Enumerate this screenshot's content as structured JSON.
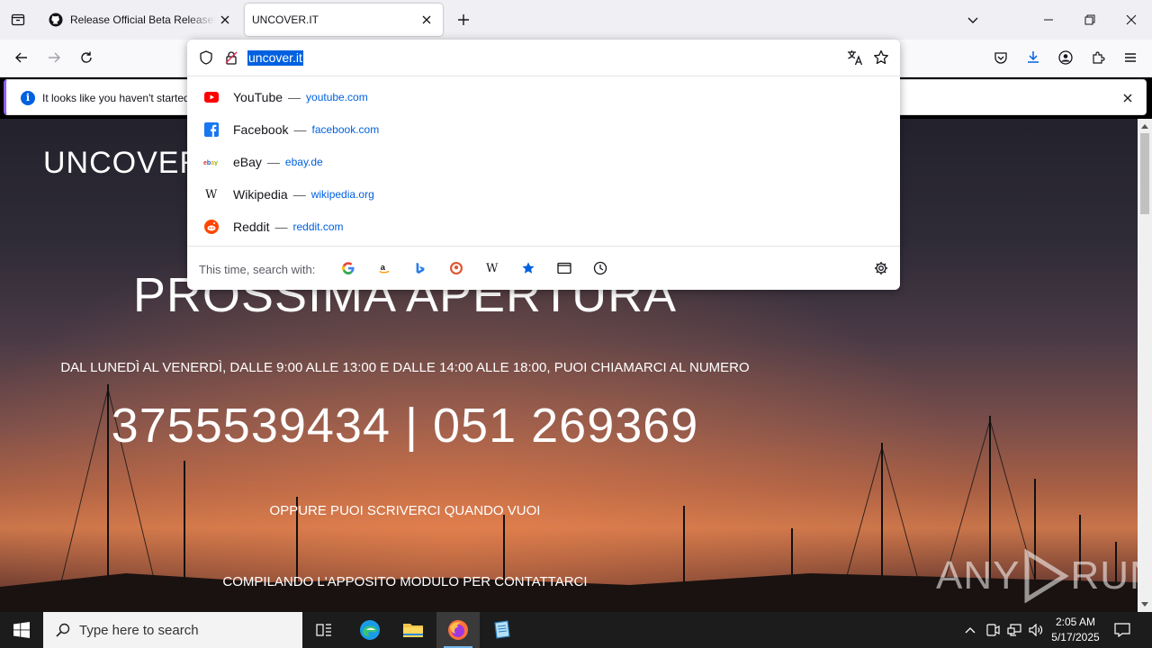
{
  "browser": {
    "tabs": [
      {
        "title": "Release Official Beta Release! · B",
        "icon": "github-icon",
        "active": false
      },
      {
        "title": "UNCOVER.IT",
        "active": true
      }
    ],
    "url": "uncover.it",
    "notification": "It looks like you haven't started"
  },
  "urlbar_dropdown": {
    "results": [
      {
        "name": "YouTube",
        "url": "youtube.com",
        "icon": "youtube-icon",
        "color": "#ff0000"
      },
      {
        "name": "Facebook",
        "url": "facebook.com",
        "icon": "facebook-icon",
        "color": "#1877f2"
      },
      {
        "name": "eBay",
        "url": "ebay.de",
        "icon": "ebay-icon"
      },
      {
        "name": "Wikipedia",
        "url": "wikipedia.org",
        "icon": "wikipedia-icon"
      },
      {
        "name": "Reddit",
        "url": "reddit.com",
        "icon": "reddit-icon",
        "color": "#ff4500"
      }
    ],
    "separator": "—",
    "search_label": "This time, search with:",
    "engines": [
      "google-icon",
      "amazon-icon",
      "bing-icon",
      "duckduckgo-icon",
      "wikipedia-icon",
      "bookmarks-icon",
      "tabs-icon",
      "history-icon"
    ]
  },
  "page": {
    "logo": "UNCOVER",
    "title": "PROSSIMA APERTURA",
    "subtitle": "DAL LUNEDÌ AL VENERDÌ, DALLE 9:00 ALLE 13:00 E DALLE 14:00 ALLE 18:00, PUOI CHIAMARCI AL NUMERO",
    "phone": "3755539434 | 051 269369",
    "line1": "OPPURE PUOI SCRIVERCI QUANDO VUOI",
    "line2": "COMPILANDO L'APPOSITO MODULO PER CONTATTARCI",
    "watermark_left": "ANY",
    "watermark_right": "RUN"
  },
  "taskbar": {
    "search_placeholder": "Type here to search",
    "time": "2:05 AM",
    "date": "5/17/2025"
  },
  "colors": {
    "accent": "#0061e0",
    "notification_stripe": "#8f5cff",
    "taskbar": "#1c1c1c"
  }
}
